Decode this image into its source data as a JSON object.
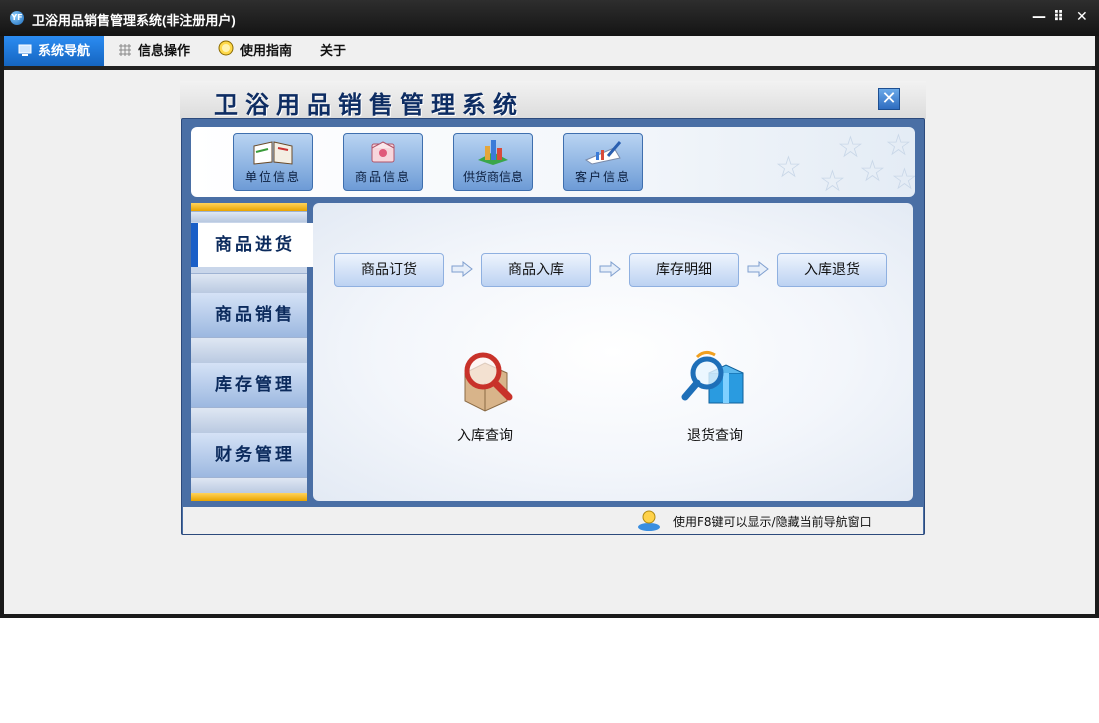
{
  "window": {
    "title": "卫浴用品销售管理系统(非注册用户)",
    "controls": {
      "minimize": "—",
      "restore": "⠿",
      "close": "✕"
    }
  },
  "menu": {
    "tabs": [
      {
        "label": "系统导航",
        "active": true
      },
      {
        "label": "信息操作",
        "active": false
      },
      {
        "label": "使用指南",
        "active": false
      },
      {
        "label": "关于",
        "active": false
      }
    ]
  },
  "nav_panel": {
    "title": "卫浴用品销售管理系统",
    "close_label": "✕",
    "toolbar": [
      {
        "label": "单位信息",
        "icon": "book-icon"
      },
      {
        "label": "商品信息",
        "icon": "box-icon"
      },
      {
        "label": "供货商信息",
        "icon": "bar-chart-icon"
      },
      {
        "label": "客户信息",
        "icon": "pen-chart-icon"
      }
    ],
    "sidebar": [
      {
        "label": "商品进货",
        "active": true
      },
      {
        "label": "商品销售",
        "active": false
      },
      {
        "label": "库存管理",
        "active": false
      },
      {
        "label": "财务管理",
        "active": false
      }
    ],
    "flow": [
      "商品订货",
      "商品入库",
      "库存明细",
      "入库退货"
    ],
    "queries": [
      {
        "label": "入库查询",
        "icon": "magnifier-box-icon"
      },
      {
        "label": "退货查询",
        "icon": "magnifier-gift-icon"
      }
    ],
    "status_text": "使用F8键可以显示/隐藏当前导航窗口"
  },
  "colors": {
    "titlebar": "#1a1a1a",
    "active_tab": "#1a73d9",
    "nav_frame": "#4a6fa5",
    "accent_bar": "#f0b400",
    "title_text": "#0e2d63"
  }
}
